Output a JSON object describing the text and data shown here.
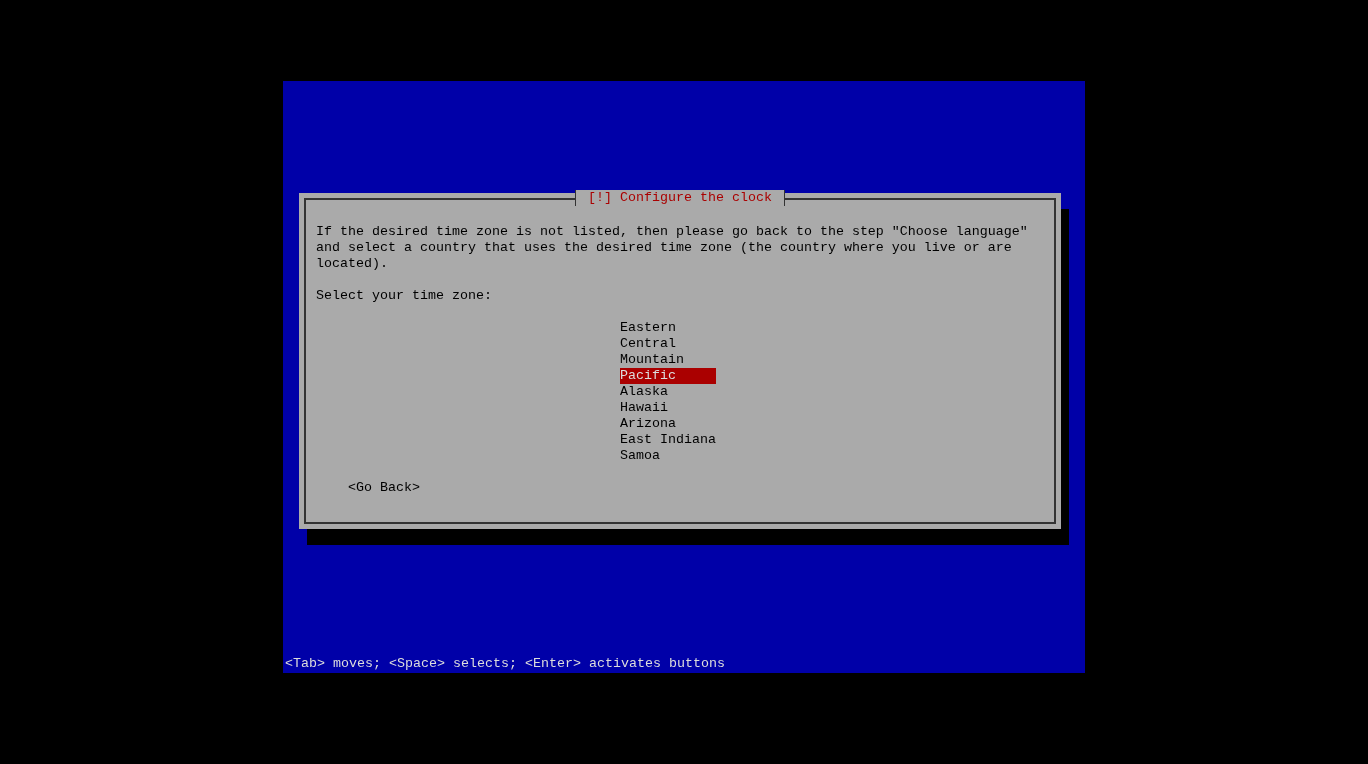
{
  "dialog": {
    "title": "[!] Configure the clock",
    "message": "If the desired time zone is not listed, then please go back to the step \"Choose language\" and select a country that uses the desired time zone (the country where you live or are located).",
    "prompt": "Select your time zone:",
    "timezones": [
      {
        "label": "Eastern",
        "selected": false
      },
      {
        "label": "Central",
        "selected": false
      },
      {
        "label": "Mountain",
        "selected": false
      },
      {
        "label": "Pacific",
        "selected": true
      },
      {
        "label": "Alaska",
        "selected": false
      },
      {
        "label": "Hawaii",
        "selected": false
      },
      {
        "label": "Arizona",
        "selected": false
      },
      {
        "label": "East Indiana",
        "selected": false
      },
      {
        "label": "Samoa",
        "selected": false
      }
    ],
    "buttons": [
      "<Go Back>"
    ]
  },
  "status_bar": "<Tab> moves; <Space> selects; <Enter> activates buttons"
}
